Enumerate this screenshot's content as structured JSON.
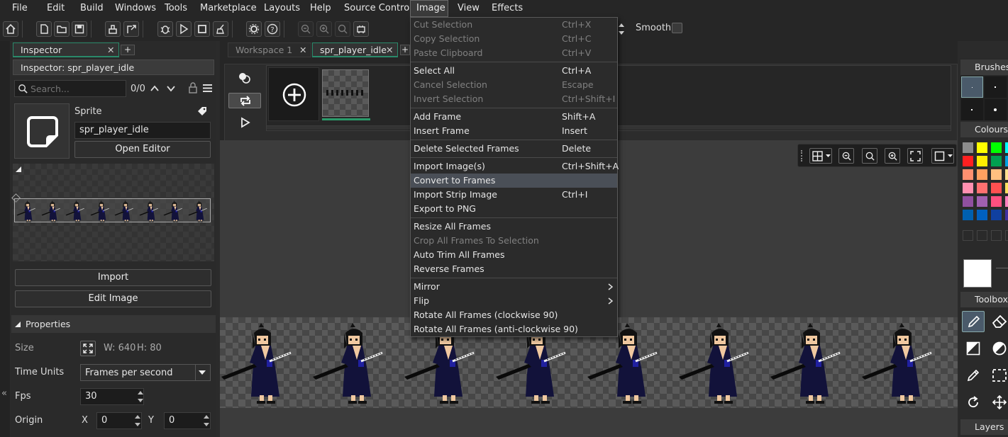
{
  "menubar": {
    "items": [
      "File",
      "Edit",
      "Build",
      "Windows",
      "Tools",
      "Marketplace",
      "Layouts",
      "Help",
      "Source Control",
      "Image",
      "View",
      "Effects"
    ],
    "active": "Image"
  },
  "toolbar": {
    "smooth_label": "Smooth",
    "icons": [
      "home-icon",
      "new-file-icon",
      "open-folder-icon",
      "save-icon",
      "clean-icon",
      "export-icon",
      "debug-icon",
      "run-icon",
      "stop-icon",
      "broom-icon",
      "settings-icon",
      "help-icon",
      "zoom-out-icon",
      "zoom-in-icon",
      "zoom-reset-icon",
      "gamepad-icon"
    ]
  },
  "inspector": {
    "tab_label": "Inspector",
    "add_tab_label": "+",
    "title": "Inspector: spr_player_idle",
    "search_placeholder": "Search...",
    "search_count": "0/0",
    "sprite_header": "Sprite",
    "sprite_name": "spr_player_idle",
    "open_editor_label": "Open Editor",
    "import_label": "Import",
    "edit_image_label": "Edit Image",
    "properties_label": "Properties",
    "size_label": "Size",
    "width_text": "W: 640",
    "height_text": "H: 80",
    "time_units_label": "Time Units",
    "time_units_value": "Frames per second",
    "fps_label": "Fps",
    "fps_value": "30",
    "origin_label": "Origin",
    "origin_x_label": "X",
    "origin_x_value": "0",
    "origin_y_label": "Y",
    "origin_y_value": "0",
    "frame_count": 8
  },
  "workspace": {
    "tabs": [
      {
        "label": "Workspace 1",
        "active": false
      },
      {
        "label": "spr_player_idle",
        "active": true
      }
    ],
    "add_tab_label": "+",
    "sprite_frames_count": 8
  },
  "image_menu": {
    "items": [
      {
        "label": "Cut Selection",
        "shortcut": "Ctrl+X",
        "disabled": true
      },
      {
        "label": "Copy Selection",
        "shortcut": "Ctrl+C",
        "disabled": true
      },
      {
        "label": "Paste Clipboard",
        "shortcut": "Ctrl+V",
        "disabled": true
      },
      {
        "separator": true
      },
      {
        "label": "Select All",
        "shortcut": "Ctrl+A"
      },
      {
        "label": "Cancel Selection",
        "shortcut": "Escape",
        "disabled": true
      },
      {
        "label": "Invert Selection",
        "shortcut": "Ctrl+Shift+I",
        "disabled": true
      },
      {
        "separator": true
      },
      {
        "label": "Add Frame",
        "shortcut": "Shift+A"
      },
      {
        "label": "Insert Frame",
        "shortcut": "Insert"
      },
      {
        "separator": true
      },
      {
        "label": "Delete Selected Frames",
        "shortcut": "Delete"
      },
      {
        "separator": true
      },
      {
        "label": "Import Image(s)",
        "shortcut": "Ctrl+Shift+A"
      },
      {
        "label": "Convert to Frames",
        "shortcut": "",
        "highlighted": true
      },
      {
        "label": "Import Strip Image",
        "shortcut": "Ctrl+I"
      },
      {
        "label": "Export to PNG",
        "shortcut": ""
      },
      {
        "separator": true
      },
      {
        "label": "Resize All Frames",
        "shortcut": ""
      },
      {
        "label": "Crop All Frames To Selection",
        "shortcut": "",
        "disabled": true
      },
      {
        "label": "Auto Trim All Frames",
        "shortcut": ""
      },
      {
        "label": "Reverse Frames",
        "shortcut": ""
      },
      {
        "separator": true
      },
      {
        "label": "Mirror",
        "shortcut": "",
        "submenu": true
      },
      {
        "label": "Flip",
        "shortcut": "",
        "submenu": true
      },
      {
        "label": "Rotate All Frames (clockwise 90)",
        "shortcut": ""
      },
      {
        "label": "Rotate All Frames (anti-clockwise 90)",
        "shortcut": ""
      }
    ]
  },
  "right_panel": {
    "brushes_label": "Brushes",
    "colours_label": "Colours",
    "toolbox_label": "Toolbox",
    "layers_label": "Layers",
    "palette": [
      [
        "#8c8c8c",
        "#ffff00",
        "#00ff00",
        "#00ffff"
      ],
      [
        "#ff2020",
        "#ffee00",
        "#00a050",
        "#00a0e0"
      ],
      [
        "#ff9070",
        "#ffa060",
        "#ffc080",
        "#ffe090"
      ],
      [
        "#ff90b0",
        "#ff7070",
        "#ff5050",
        "#ffe060"
      ],
      [
        "#9050a0",
        "#a060b0",
        "#ff5080",
        "#ff80c0"
      ],
      [
        "#0060b0",
        "#0060c0",
        "#1040a0",
        "#4030a0"
      ]
    ],
    "current_colour": "#ffffff"
  }
}
